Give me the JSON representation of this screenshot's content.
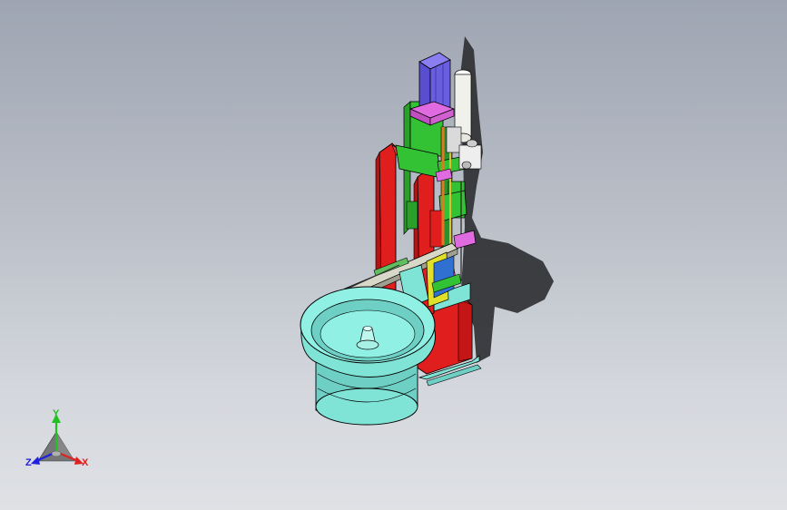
{
  "viewport": {
    "background_top": "#9ea5b2",
    "background_bottom": "#dfe1e5"
  },
  "model": {
    "colors": {
      "frame_red": "#e01e1e",
      "plate_green": "#33c233",
      "bowl_cyan": "#7fe3d6",
      "cylinder_blue": "#6a5ee0",
      "accent_magenta": "#e06be0",
      "valve_white": "#f1f1ec",
      "rail_yellow": "#e0e02a",
      "shadow": "#2c2d31"
    }
  },
  "triad": {
    "labels": {
      "x": "X",
      "y": "Y",
      "z": "Z"
    },
    "colors": {
      "x": "#e02020",
      "y": "#20c020",
      "z": "#2020e0"
    }
  }
}
